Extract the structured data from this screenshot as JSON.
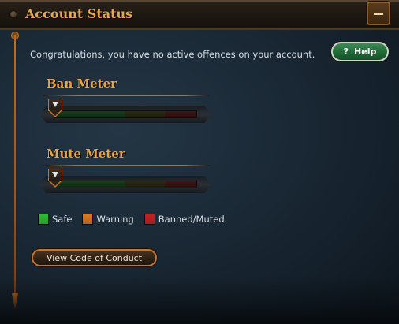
{
  "window": {
    "title": "Account Status"
  },
  "status": {
    "message": "Congratulations, you have no active offences on your account."
  },
  "help_button": {
    "icon": "question-mark-icon",
    "icon_glyph": "?",
    "label": "Help"
  },
  "meters": {
    "ban": {
      "title": "Ban Meter",
      "level": 0
    },
    "mute": {
      "title": "Mute Meter",
      "level": 0
    }
  },
  "legend": [
    {
      "label": "Safe",
      "color": "#2fbf2f"
    },
    {
      "label": "Warning",
      "color": "#e07a18"
    },
    {
      "label": "Banned/Muted",
      "color": "#c81f1f"
    }
  ],
  "conduct_button": {
    "label": "View Code of Conduct"
  },
  "colors": {
    "accent": "#e6a64a",
    "help_green": "#1f6a35",
    "frame_orange": "#c4772c"
  }
}
